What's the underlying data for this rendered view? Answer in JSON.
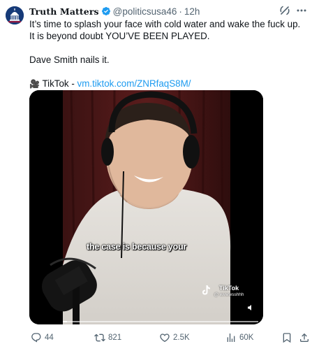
{
  "author": {
    "display_name": "Truth Matters",
    "handle": "@politicsusa46",
    "time": "12h",
    "verified": true
  },
  "tweet": {
    "lines": [
      "It’s time to splash your face with cold water and wake the fuck up. It is beyond doubt YOU’VE BEEN PLAYED.",
      "Dave Smith nails it."
    ],
    "source_label": "TikTok - ",
    "source_link": "vm.tiktok.com/ZNRfaqS8M/"
  },
  "video": {
    "caption": "the case is because your",
    "watermark": "TikTok",
    "watermark_user": "@ wvwwsshhh",
    "progress": 0.02
  },
  "actions": {
    "replies": "44",
    "reposts": "821",
    "likes": "2.5K",
    "views": "60K"
  },
  "colors": {
    "link": "#1d9bf0",
    "secondary_text": "#536471",
    "verified": "#1d9bf0"
  }
}
